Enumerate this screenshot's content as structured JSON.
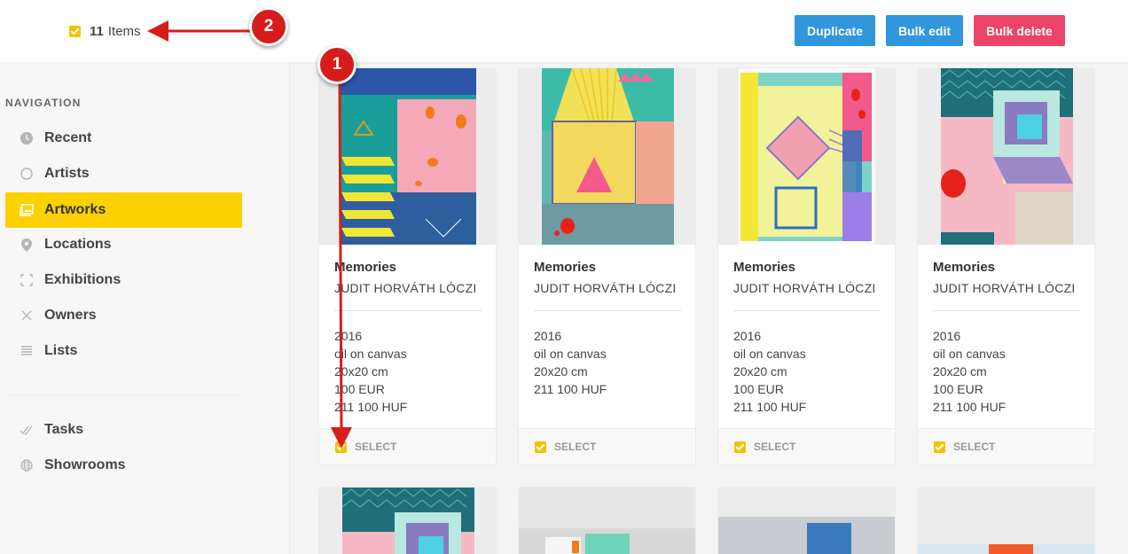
{
  "header": {
    "count": "11",
    "count_label": "Items",
    "duplicate_label": "Duplicate",
    "bulk_edit_label": "Bulk edit",
    "bulk_delete_label": "Bulk delete"
  },
  "sidebar": {
    "title": "NAVIGATION",
    "items": [
      {
        "label": "Recent",
        "icon": "clock-icon"
      },
      {
        "label": "Artists",
        "icon": "circle-icon"
      },
      {
        "label": "Artworks",
        "icon": "image-icon",
        "active": true
      },
      {
        "label": "Locations",
        "icon": "pin-icon"
      },
      {
        "label": "Exhibitions",
        "icon": "frame-icon"
      },
      {
        "label": "Owners",
        "icon": "cross-icon"
      },
      {
        "label": "Lists",
        "icon": "list-icon"
      },
      {
        "label": "Tasks",
        "icon": "check-double-icon"
      },
      {
        "label": "Showrooms",
        "icon": "globe-icon"
      }
    ]
  },
  "artworks": [
    {
      "title": "Memories",
      "artist": "JUDIT HORVÁTH LÓCZI",
      "year": "2016",
      "medium": "oil on canvas",
      "size": "20x20 cm",
      "price_eur": "100 EUR",
      "price_huf": "211 100 HUF",
      "select_label": "SELECT"
    },
    {
      "title": "Memories",
      "artist": "JUDIT HORVÁTH LÓCZI",
      "year": "2016",
      "medium": "oil on canvas",
      "size": "20x20 cm",
      "price_eur": "211 100 HUF",
      "price_huf": "",
      "select_label": "SELECT"
    },
    {
      "title": "Memories",
      "artist": "JUDIT HORVÁTH LÓCZI",
      "year": "2016",
      "medium": "oil on canvas",
      "size": "20x20 cm",
      "price_eur": "100 EUR",
      "price_huf": "211 100 HUF",
      "select_label": "SELECT"
    },
    {
      "title": "Memories",
      "artist": "JUDIT HORVÁTH LÓCZI",
      "year": "2016",
      "medium": "oil on canvas",
      "size": "20x20 cm",
      "price_eur": "100 EUR",
      "price_huf": "211 100 HUF",
      "select_label": "SELECT"
    }
  ],
  "annotations": {
    "badge_1": "1",
    "badge_2": "2"
  },
  "colors": {
    "accent_yellow": "#fcd100",
    "button_blue": "#3197dc",
    "button_red": "#ec4468",
    "annotation_red": "#d81c1c"
  }
}
